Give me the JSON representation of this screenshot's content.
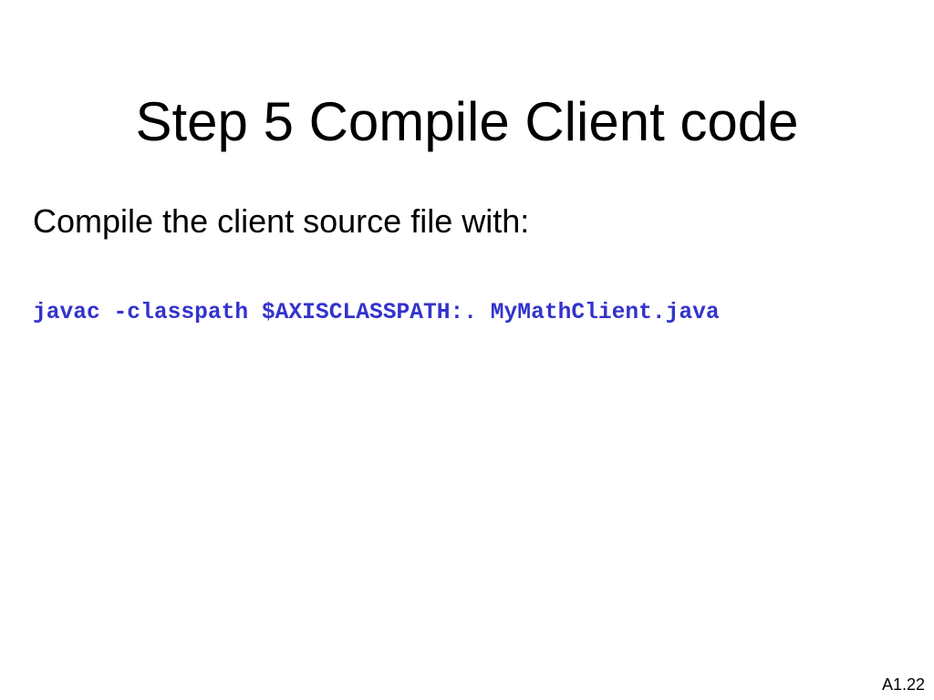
{
  "slide": {
    "title": "Step 5 Compile Client code",
    "body_text": "Compile the client source file with:",
    "code": "javac -classpath $AXISCLASSPATH:. MyMathClient.java",
    "slide_number": "A1.22"
  },
  "colors": {
    "code_text": "#3333cc",
    "text": "#000000",
    "background": "#ffffff"
  }
}
